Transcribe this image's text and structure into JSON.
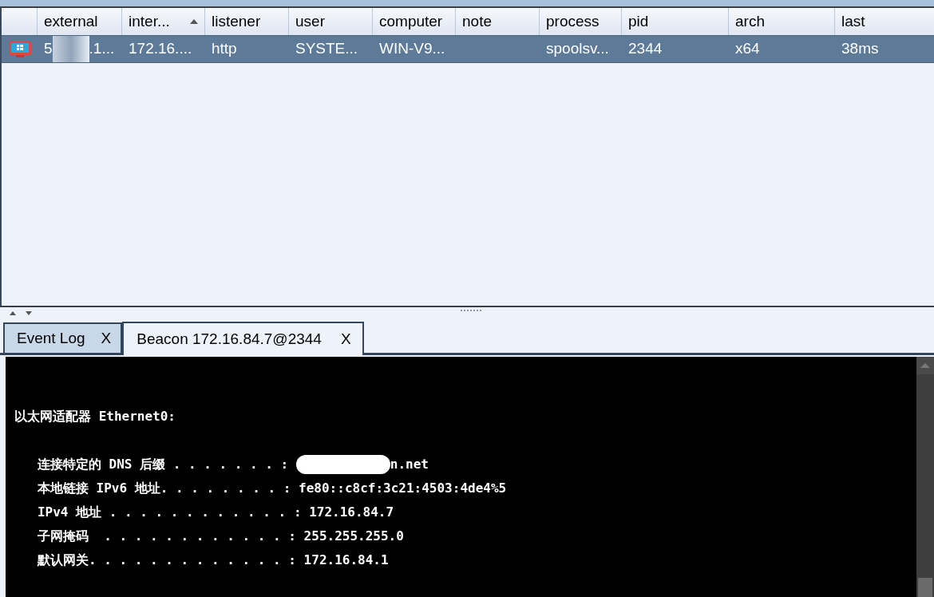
{
  "table": {
    "columns": [
      {
        "label": "external",
        "sorted": false
      },
      {
        "label": "inter...",
        "sorted": true
      },
      {
        "label": "listener",
        "sorted": false
      },
      {
        "label": "user",
        "sorted": false
      },
      {
        "label": "computer",
        "sorted": false
      },
      {
        "label": "note",
        "sorted": false
      },
      {
        "label": "process",
        "sorted": false
      },
      {
        "label": "pid",
        "sorted": false
      },
      {
        "label": "arch",
        "sorted": false
      },
      {
        "label": "last",
        "sorted": false
      }
    ],
    "rows": [
      {
        "selected": true,
        "cells": [
          {
            "before": "5",
            "after": ".1..."
          },
          "172.16....",
          "http",
          "SYSTE...",
          "WIN-V9...",
          "",
          "spoolsv...",
          "2344",
          "x64",
          "38ms"
        ]
      }
    ]
  },
  "tabs": [
    {
      "label": "Event Log",
      "close": "X",
      "selected": false
    },
    {
      "label": "Beacon 172.16.84.7@2344",
      "close": "X",
      "selected": true
    }
  ],
  "console": {
    "lines": [
      {
        "kind": "blank"
      },
      {
        "kind": "blank"
      },
      {
        "kind": "text",
        "text": "以太网适配器 Ethernet0:"
      },
      {
        "kind": "blank"
      },
      {
        "kind": "redacted",
        "before": "   连接特定的 DNS 后缀 . . . . . . . : ",
        "after": "n.net"
      },
      {
        "kind": "text",
        "text": "   本地链接 IPv6 地址. . . . . . . . : fe80::c8cf:3c21:4503:4de4%5"
      },
      {
        "kind": "text",
        "text": "   IPv4 地址 . . . . . . . . . . . . : 172.16.84.7"
      },
      {
        "kind": "text",
        "text": "   子网掩码  . . . . . . . . . . . . : 255.255.255.0"
      },
      {
        "kind": "text",
        "text": "   默认网关. . . . . . . . . . . . . : 172.16.84.1"
      }
    ]
  }
}
